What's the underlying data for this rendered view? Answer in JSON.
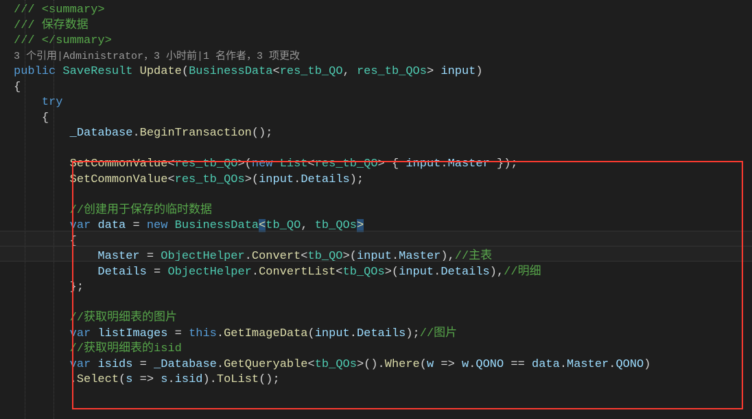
{
  "codelens": "3 个引用|Administrator，3 小时前|1 名作者，3 项更改",
  "lines": [
    [
      [
        "c-comment",
        "/// <summary>"
      ]
    ],
    [
      [
        "c-comment",
        "/// 保存数据"
      ]
    ],
    [
      [
        "c-comment",
        "/// </summary>"
      ]
    ],
    [
      [
        "c-keyword",
        "public"
      ],
      [
        "",
        " "
      ],
      [
        "c-type",
        "SaveResult"
      ],
      [
        "",
        " "
      ],
      [
        "c-method",
        "Update"
      ],
      [
        "c-punct",
        "("
      ],
      [
        "c-type",
        "BusinessData"
      ],
      [
        "c-punct",
        "<"
      ],
      [
        "c-type",
        "res_tb_QO"
      ],
      [
        "c-punct",
        ", "
      ],
      [
        "c-type",
        "res_tb_QOs"
      ],
      [
        "c-punct",
        "> "
      ],
      [
        "c-ident",
        "input"
      ],
      [
        "c-punct",
        ")"
      ]
    ],
    [
      [
        "c-punct",
        "{"
      ]
    ],
    [
      [
        "",
        "    "
      ],
      [
        "c-keyword",
        "try"
      ]
    ],
    [
      [
        "",
        "    "
      ],
      [
        "c-punct",
        "{"
      ]
    ],
    [
      [
        "",
        "        "
      ],
      [
        "c-ident",
        "_Database"
      ],
      [
        "c-punct",
        "."
      ],
      [
        "c-method",
        "BeginTransaction"
      ],
      [
        "c-punct",
        "();"
      ]
    ],
    [
      [
        "",
        ""
      ]
    ],
    [
      [
        "",
        "        "
      ],
      [
        "c-method",
        "SetCommonValue"
      ],
      [
        "c-punct",
        "<"
      ],
      [
        "c-type",
        "res_tb_QO"
      ],
      [
        "c-punct",
        ">("
      ],
      [
        "c-keyword",
        "new"
      ],
      [
        "",
        " "
      ],
      [
        "c-type",
        "List"
      ],
      [
        "c-punct",
        "<"
      ],
      [
        "c-type",
        "res_tb_QO"
      ],
      [
        "c-punct",
        "> { "
      ],
      [
        "c-ident",
        "input"
      ],
      [
        "c-punct",
        "."
      ],
      [
        "c-ident",
        "Master"
      ],
      [
        "c-punct",
        " });"
      ]
    ],
    [
      [
        "",
        "        "
      ],
      [
        "c-method",
        "SetCommonValue"
      ],
      [
        "c-punct",
        "<"
      ],
      [
        "c-type",
        "res_tb_QOs"
      ],
      [
        "c-punct",
        ">("
      ],
      [
        "c-ident",
        "input"
      ],
      [
        "c-punct",
        "."
      ],
      [
        "c-ident",
        "Details"
      ],
      [
        "c-punct",
        ");"
      ]
    ],
    [
      [
        "",
        ""
      ]
    ],
    [
      [
        "",
        "        "
      ],
      [
        "c-comment",
        "//创建用于保存的临时数据"
      ]
    ],
    [
      [
        "",
        "        "
      ],
      [
        "c-keyword",
        "var"
      ],
      [
        "",
        " "
      ],
      [
        "c-ident",
        "data"
      ],
      [
        "",
        " "
      ],
      [
        "c-op",
        "="
      ],
      [
        "",
        " "
      ],
      [
        "c-keyword",
        "new"
      ],
      [
        "",
        " "
      ],
      [
        "c-type",
        "BusinessData"
      ],
      [
        "highlight-bracket",
        "<"
      ],
      [
        "c-type",
        "tb_QO"
      ],
      [
        "c-punct",
        ", "
      ],
      [
        "c-type",
        "tb_QOs"
      ],
      [
        "highlight-bracket",
        ">"
      ]
    ],
    [
      [
        "",
        "        "
      ],
      [
        "c-punct",
        "{"
      ]
    ],
    [
      [
        "",
        "            "
      ],
      [
        "c-ident",
        "Master"
      ],
      [
        "",
        " "
      ],
      [
        "c-op",
        "="
      ],
      [
        "",
        " "
      ],
      [
        "c-type",
        "ObjectHelper"
      ],
      [
        "c-punct",
        "."
      ],
      [
        "c-method",
        "Convert"
      ],
      [
        "c-punct",
        "<"
      ],
      [
        "c-type",
        "tb_QO"
      ],
      [
        "c-punct",
        ">("
      ],
      [
        "c-ident",
        "input"
      ],
      [
        "c-punct",
        "."
      ],
      [
        "c-ident",
        "Master"
      ],
      [
        "c-punct",
        "),"
      ],
      [
        "c-comment",
        "//主表"
      ]
    ],
    [
      [
        "",
        "            "
      ],
      [
        "c-ident",
        "Details"
      ],
      [
        "",
        " "
      ],
      [
        "c-op",
        "="
      ],
      [
        "",
        " "
      ],
      [
        "c-type",
        "ObjectHelper"
      ],
      [
        "c-punct",
        "."
      ],
      [
        "c-method",
        "ConvertList"
      ],
      [
        "c-punct",
        "<"
      ],
      [
        "c-type",
        "tb_QOs"
      ],
      [
        "c-punct",
        ">("
      ],
      [
        "c-ident",
        "input"
      ],
      [
        "c-punct",
        "."
      ],
      [
        "c-ident",
        "Details"
      ],
      [
        "c-punct",
        "),"
      ],
      [
        "c-comment",
        "//明细"
      ]
    ],
    [
      [
        "",
        "        "
      ],
      [
        "c-punct",
        "};"
      ]
    ],
    [
      [
        "",
        ""
      ]
    ],
    [
      [
        "",
        "        "
      ],
      [
        "c-comment",
        "//获取明细表的图片"
      ]
    ],
    [
      [
        "",
        "        "
      ],
      [
        "c-keyword",
        "var"
      ],
      [
        "",
        " "
      ],
      [
        "c-ident",
        "listImages"
      ],
      [
        "",
        " "
      ],
      [
        "c-op",
        "="
      ],
      [
        "",
        " "
      ],
      [
        "c-keyword",
        "this"
      ],
      [
        "c-punct",
        "."
      ],
      [
        "c-method",
        "GetImageData"
      ],
      [
        "c-punct",
        "("
      ],
      [
        "c-ident",
        "input"
      ],
      [
        "c-punct",
        "."
      ],
      [
        "c-ident",
        "Details"
      ],
      [
        "c-punct",
        ");"
      ],
      [
        "c-comment",
        "//图片"
      ]
    ],
    [
      [
        "",
        "        "
      ],
      [
        "c-comment",
        "//获取明细表的isid"
      ]
    ],
    [
      [
        "",
        "        "
      ],
      [
        "c-keyword",
        "var"
      ],
      [
        "",
        " "
      ],
      [
        "c-ident",
        "isids"
      ],
      [
        "",
        " "
      ],
      [
        "c-op",
        "="
      ],
      [
        "",
        " "
      ],
      [
        "c-ident",
        "_Database"
      ],
      [
        "c-punct",
        "."
      ],
      [
        "c-method",
        "GetQueryable"
      ],
      [
        "c-punct",
        "<"
      ],
      [
        "c-type",
        "tb_QOs"
      ],
      [
        "c-punct",
        ">()."
      ],
      [
        "c-method",
        "Where"
      ],
      [
        "c-punct",
        "("
      ],
      [
        "c-ident",
        "w"
      ],
      [
        "",
        " "
      ],
      [
        "c-op",
        "=>"
      ],
      [
        "",
        " "
      ],
      [
        "c-ident",
        "w"
      ],
      [
        "c-punct",
        "."
      ],
      [
        "c-ident",
        "QONO"
      ],
      [
        "",
        " "
      ],
      [
        "c-op",
        "=="
      ],
      [
        "",
        " "
      ],
      [
        "c-ident",
        "data"
      ],
      [
        "c-punct",
        "."
      ],
      [
        "c-ident",
        "Master"
      ],
      [
        "c-punct",
        "."
      ],
      [
        "c-ident",
        "QONO"
      ],
      [
        "c-punct",
        ")"
      ]
    ],
    [
      [
        "",
        "        "
      ],
      [
        "c-punct",
        "."
      ],
      [
        "c-method",
        "Select"
      ],
      [
        "c-punct",
        "("
      ],
      [
        "c-ident",
        "s"
      ],
      [
        "",
        " "
      ],
      [
        "c-op",
        "=>"
      ],
      [
        "",
        " "
      ],
      [
        "c-ident",
        "s"
      ],
      [
        "c-punct",
        "."
      ],
      [
        "c-ident",
        "isid"
      ],
      [
        "c-punct",
        ")."
      ],
      [
        "c-method",
        "ToList"
      ],
      [
        "c-punct",
        "();"
      ]
    ],
    [
      [
        "",
        ""
      ]
    ]
  ],
  "indent_guides": [
    36,
    78
  ]
}
